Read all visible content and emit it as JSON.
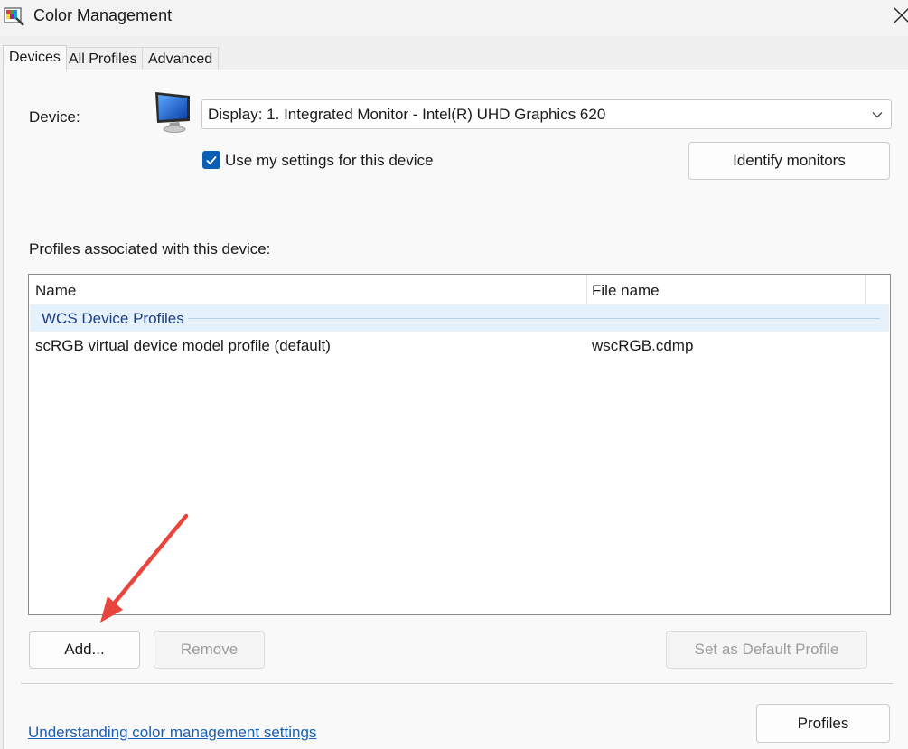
{
  "window": {
    "title": "Color Management"
  },
  "tabs": [
    {
      "label": "Devices",
      "active": true
    },
    {
      "label": "All Profiles",
      "active": false
    },
    {
      "label": "Advanced",
      "active": false
    }
  ],
  "device": {
    "label": "Device:",
    "selected": "Display: 1. Integrated Monitor - Intel(R) UHD Graphics 620",
    "use_my_settings_label": "Use my settings for this device",
    "use_my_settings_checked": true,
    "identify_label": "Identify monitors"
  },
  "profiles": {
    "section_label": "Profiles associated with this device:",
    "columns": [
      "Name",
      "File name"
    ],
    "group": "WCS Device Profiles",
    "rows": [
      {
        "name": "scRGB virtual device model profile (default)",
        "file": "wscRGB.cdmp"
      }
    ]
  },
  "buttons": {
    "add": "Add...",
    "remove": "Remove",
    "set_default": "Set as Default Profile",
    "profiles": "Profiles"
  },
  "footer": {
    "link": "Understanding color management settings"
  },
  "colors": {
    "accent": "#0a5fb4",
    "link": "#1a5fb4",
    "group_bg": "#e5f1fb",
    "annotation_arrow": "#e8453c"
  }
}
